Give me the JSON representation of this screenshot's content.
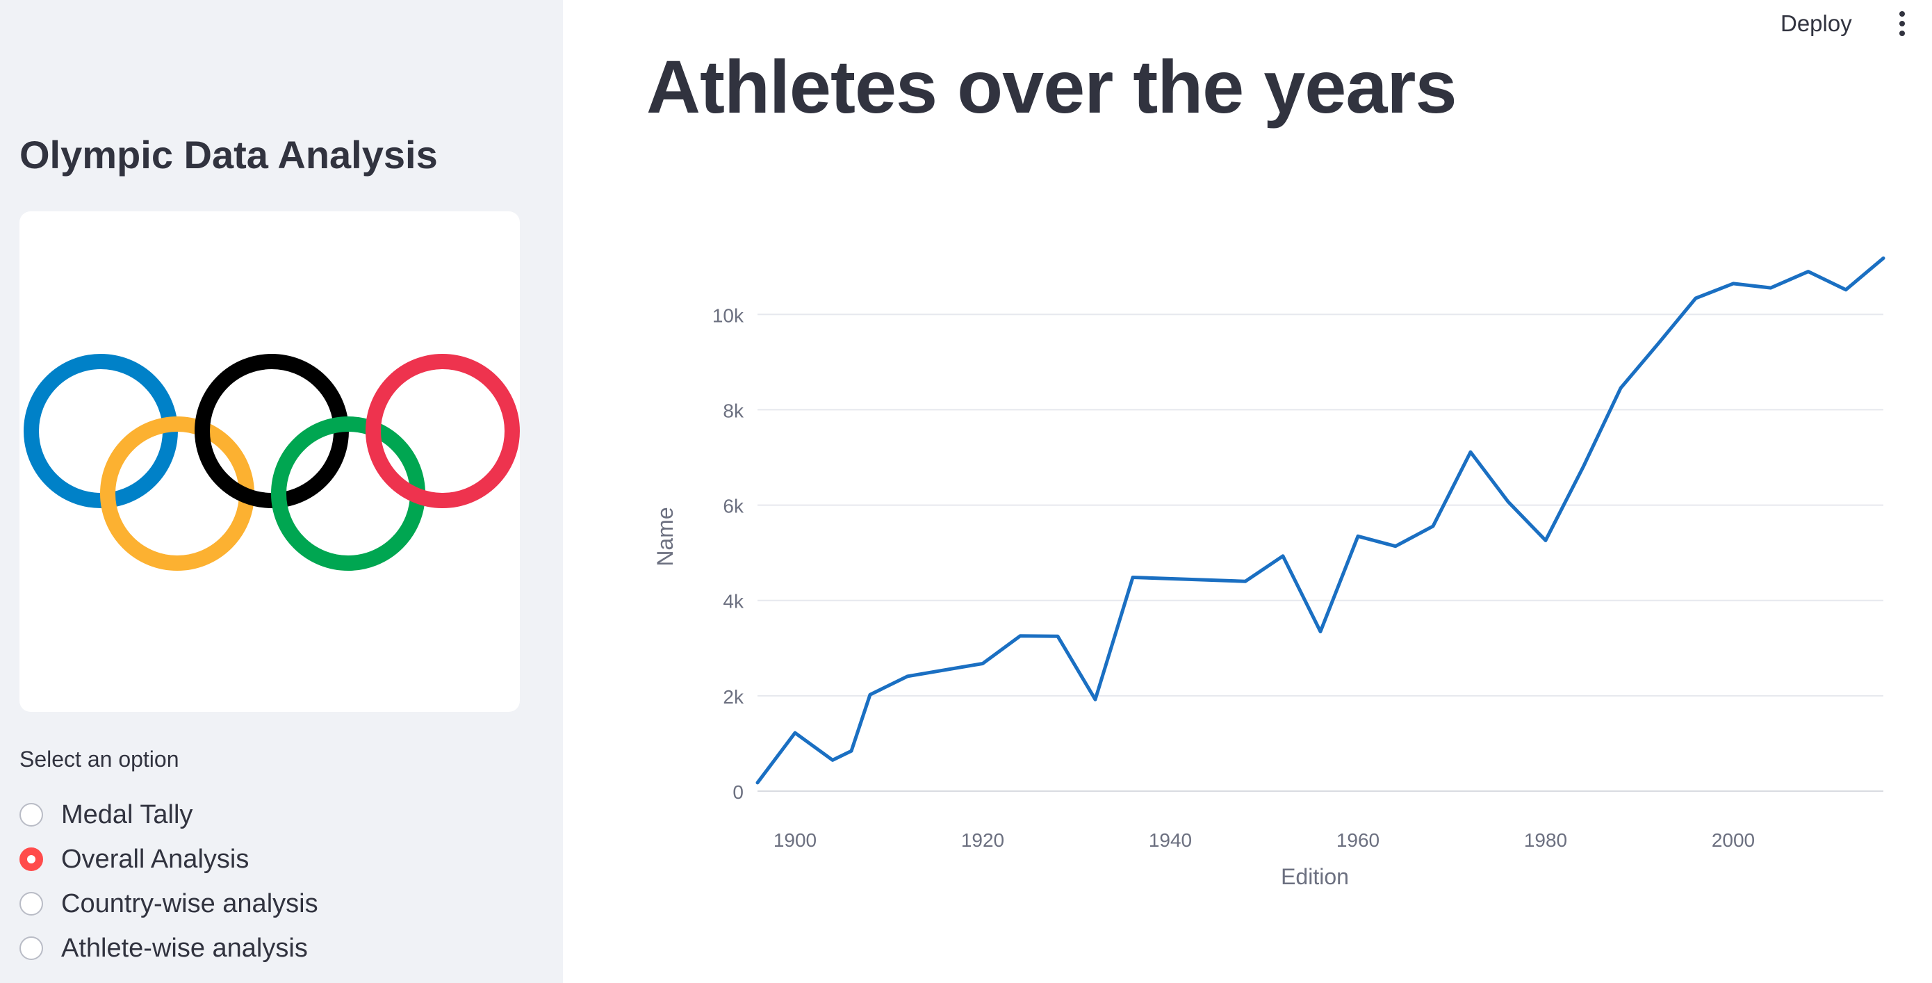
{
  "header": {
    "deploy_label": "Deploy",
    "menu_icon": "vertical-dots-icon"
  },
  "sidebar": {
    "title": "Olympic Data Analysis",
    "logo": {
      "name": "olympic-rings-logo",
      "ring_colors": [
        "#0081c8",
        "#fcb131",
        "#000000",
        "#00a651",
        "#ee334e"
      ]
    },
    "radio_label": "Select an option",
    "options": [
      {
        "label": "Medal Tally",
        "selected": false
      },
      {
        "label": "Overall Analysis",
        "selected": true
      },
      {
        "label": "Country-wise analysis",
        "selected": false
      },
      {
        "label": "Athlete-wise analysis",
        "selected": false
      }
    ],
    "accent_color": "#ff4b4b"
  },
  "main": {
    "title": "Athletes over the years"
  },
  "chart_data": {
    "type": "line",
    "xlabel": "Edition",
    "ylabel": "Name",
    "x_ticks": [
      1900,
      1920,
      1940,
      1960,
      1980,
      2000
    ],
    "y_ticks": [
      0,
      2000,
      4000,
      6000,
      8000,
      10000
    ],
    "y_tick_labels": [
      "0",
      "2k",
      "4k",
      "6k",
      "8k",
      "10k"
    ],
    "xlim": [
      1896,
      2016
    ],
    "ylim": [
      0,
      11200
    ],
    "line_color": "#1a6fc2",
    "grid": true,
    "series": [
      {
        "x": [
          1896,
          1900,
          1904,
          1906,
          1908,
          1912,
          1920,
          1924,
          1928,
          1932,
          1936,
          1948,
          1952,
          1956,
          1960,
          1964,
          1968,
          1972,
          1976,
          1980,
          1984,
          1988,
          1992,
          1996,
          2000,
          2004,
          2008,
          2012,
          2016
        ],
        "y": [
          176,
          1224,
          650,
          841,
          2024,
          2409,
          2676,
          3256,
          3247,
          1922,
          4484,
          4401,
          4932,
          3347,
          5348,
          5137,
          5558,
          7113,
          6073,
          5259,
          6797,
          8454,
          9386,
          10339,
          10647,
          10557,
          10899,
          10517,
          11179
        ]
      }
    ]
  }
}
